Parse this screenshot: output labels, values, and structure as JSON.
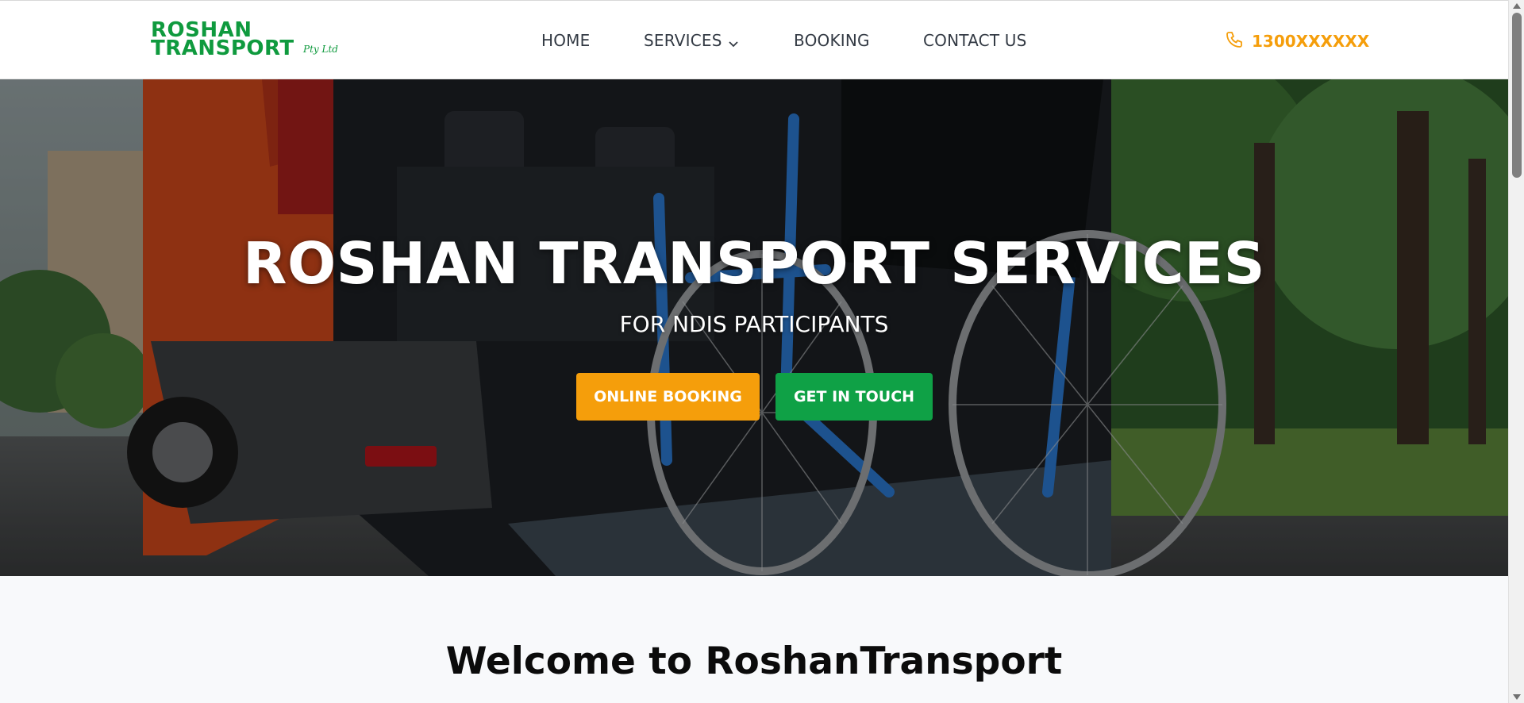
{
  "brand": {
    "line1": "ROSHAN",
    "line2": "TRANSPORT",
    "suffix": "Pty Ltd",
    "color": "#0f9a3e"
  },
  "nav": {
    "items": [
      {
        "label": "HOME"
      },
      {
        "label": "SERVICES",
        "has_dropdown": true
      },
      {
        "label": "BOOKING"
      },
      {
        "label": "CONTACT US"
      }
    ]
  },
  "phone": {
    "icon": "phone-icon",
    "number": "1300XXXXXX",
    "color": "#f59e0b"
  },
  "hero": {
    "title": "ROSHAN TRANSPORT SERVICES",
    "subtitle": "FOR NDIS PARTICIPANTS",
    "primary_button": {
      "label": "ONLINE BOOKING",
      "color": "#f59e0b"
    },
    "secondary_button": {
      "label": "GET IN TOUCH",
      "color": "#0fa146"
    }
  },
  "welcome": {
    "title": "Welcome to RoshanTransport"
  }
}
